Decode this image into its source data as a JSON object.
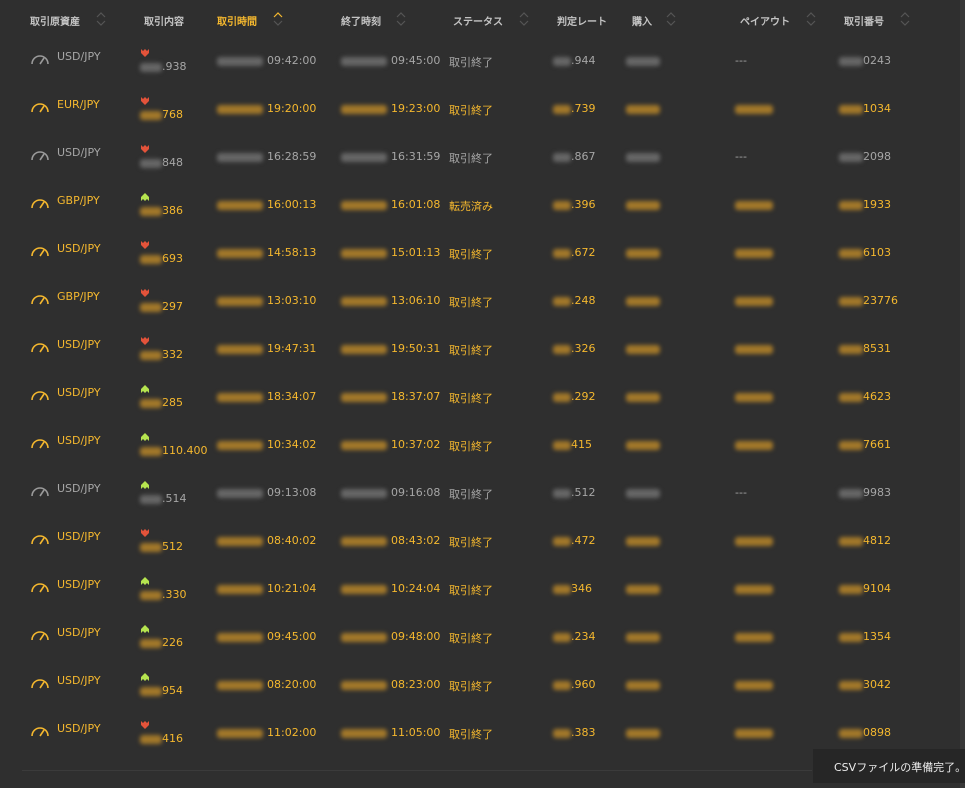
{
  "colors": {
    "accent": "#f5b82e",
    "muted": "#a6a6a6",
    "put": "#e3533a",
    "call": "#b5e44f",
    "background": "#2f2f2f"
  },
  "header": {
    "asset": "取引原資産",
    "contract": "取引内容",
    "open_time": "取引時間",
    "close_time": "終了時刻",
    "status": "ステータス",
    "rate": "判定レート",
    "purchase": "購入",
    "payout": "ペイアウト",
    "trade_id": "取引番号",
    "sorted_column": "open_time"
  },
  "rows": [
    {
      "active": false,
      "asset": "USD/JPY",
      "direction": "down",
      "contract": ".938",
      "opened": "09:42:00",
      "closed": "09:45:00",
      "status": "取引終了",
      "rate": ".944",
      "payout": "---",
      "trade_id": "0243"
    },
    {
      "active": true,
      "asset": "EUR/JPY",
      "direction": "down",
      "contract": "768",
      "opened": "19:20:00",
      "closed": "19:23:00",
      "status": "取引終了",
      "rate": ".739",
      "payout": "",
      "trade_id": "1034"
    },
    {
      "active": false,
      "asset": "USD/JPY",
      "direction": "down",
      "contract": "848",
      "opened": "16:28:59",
      "closed": "16:31:59",
      "status": "取引終了",
      "rate": ".867",
      "payout": "---",
      "trade_id": "2098"
    },
    {
      "active": true,
      "asset": "GBP/JPY",
      "direction": "up",
      "contract": "386",
      "opened": "16:00:13",
      "closed": "16:01:08",
      "status": "転売済み",
      "rate": ".396",
      "payout": "",
      "trade_id": "1933"
    },
    {
      "active": true,
      "asset": "USD/JPY",
      "direction": "down",
      "contract": "693",
      "opened": "14:58:13",
      "closed": "15:01:13",
      "status": "取引終了",
      "rate": ".672",
      "payout": "",
      "trade_id": "6103"
    },
    {
      "active": true,
      "asset": "GBP/JPY",
      "direction": "down",
      "contract": "297",
      "opened": "13:03:10",
      "closed": "13:06:10",
      "status": "取引終了",
      "rate": ".248",
      "payout": "",
      "trade_id": "23776"
    },
    {
      "active": true,
      "asset": "USD/JPY",
      "direction": "down",
      "contract": "332",
      "opened": "19:47:31",
      "closed": "19:50:31",
      "status": "取引終了",
      "rate": ".326",
      "payout": "",
      "trade_id": "8531"
    },
    {
      "active": true,
      "asset": "USD/JPY",
      "direction": "up",
      "contract": "285",
      "opened": "18:34:07",
      "closed": "18:37:07",
      "status": "取引終了",
      "rate": ".292",
      "payout": "",
      "trade_id": "4623"
    },
    {
      "active": true,
      "asset": "USD/JPY",
      "direction": "up",
      "contract": "110.400",
      "opened": "10:34:02",
      "closed": "10:37:02",
      "status": "取引終了",
      "rate": "415",
      "payout": "",
      "trade_id": "7661"
    },
    {
      "active": false,
      "asset": "USD/JPY",
      "direction": "up",
      "contract": ".514",
      "opened": "09:13:08",
      "closed": "09:16:08",
      "status": "取引終了",
      "rate": ".512",
      "payout": "---",
      "trade_id": "9983"
    },
    {
      "active": true,
      "asset": "USD/JPY",
      "direction": "down",
      "contract": "512",
      "opened": "08:40:02",
      "closed": "08:43:02",
      "status": "取引終了",
      "rate": ".472",
      "payout": "",
      "trade_id": "4812"
    },
    {
      "active": true,
      "asset": "USD/JPY",
      "direction": "up",
      "contract": ".330",
      "opened": "10:21:04",
      "closed": "10:24:04",
      "status": "取引終了",
      "rate": "346",
      "payout": "",
      "trade_id": "9104"
    },
    {
      "active": true,
      "asset": "USD/JPY",
      "direction": "up",
      "contract": "226",
      "opened": "09:45:00",
      "closed": "09:48:00",
      "status": "取引終了",
      "rate": ".234",
      "payout": "",
      "trade_id": "1354"
    },
    {
      "active": true,
      "asset": "USD/JPY",
      "direction": "up",
      "contract": "954",
      "opened": "08:20:00",
      "closed": "08:23:00",
      "status": "取引終了",
      "rate": ".960",
      "payout": "",
      "trade_id": "3042"
    },
    {
      "active": true,
      "asset": "USD/JPY",
      "direction": "down",
      "contract": "416",
      "opened": "11:02:00",
      "closed": "11:05:00",
      "status": "取引終了",
      "rate": ".383",
      "payout": "",
      "trade_id": "0898"
    }
  ],
  "toast": {
    "message": "CSVファイルの準備完了。"
  }
}
